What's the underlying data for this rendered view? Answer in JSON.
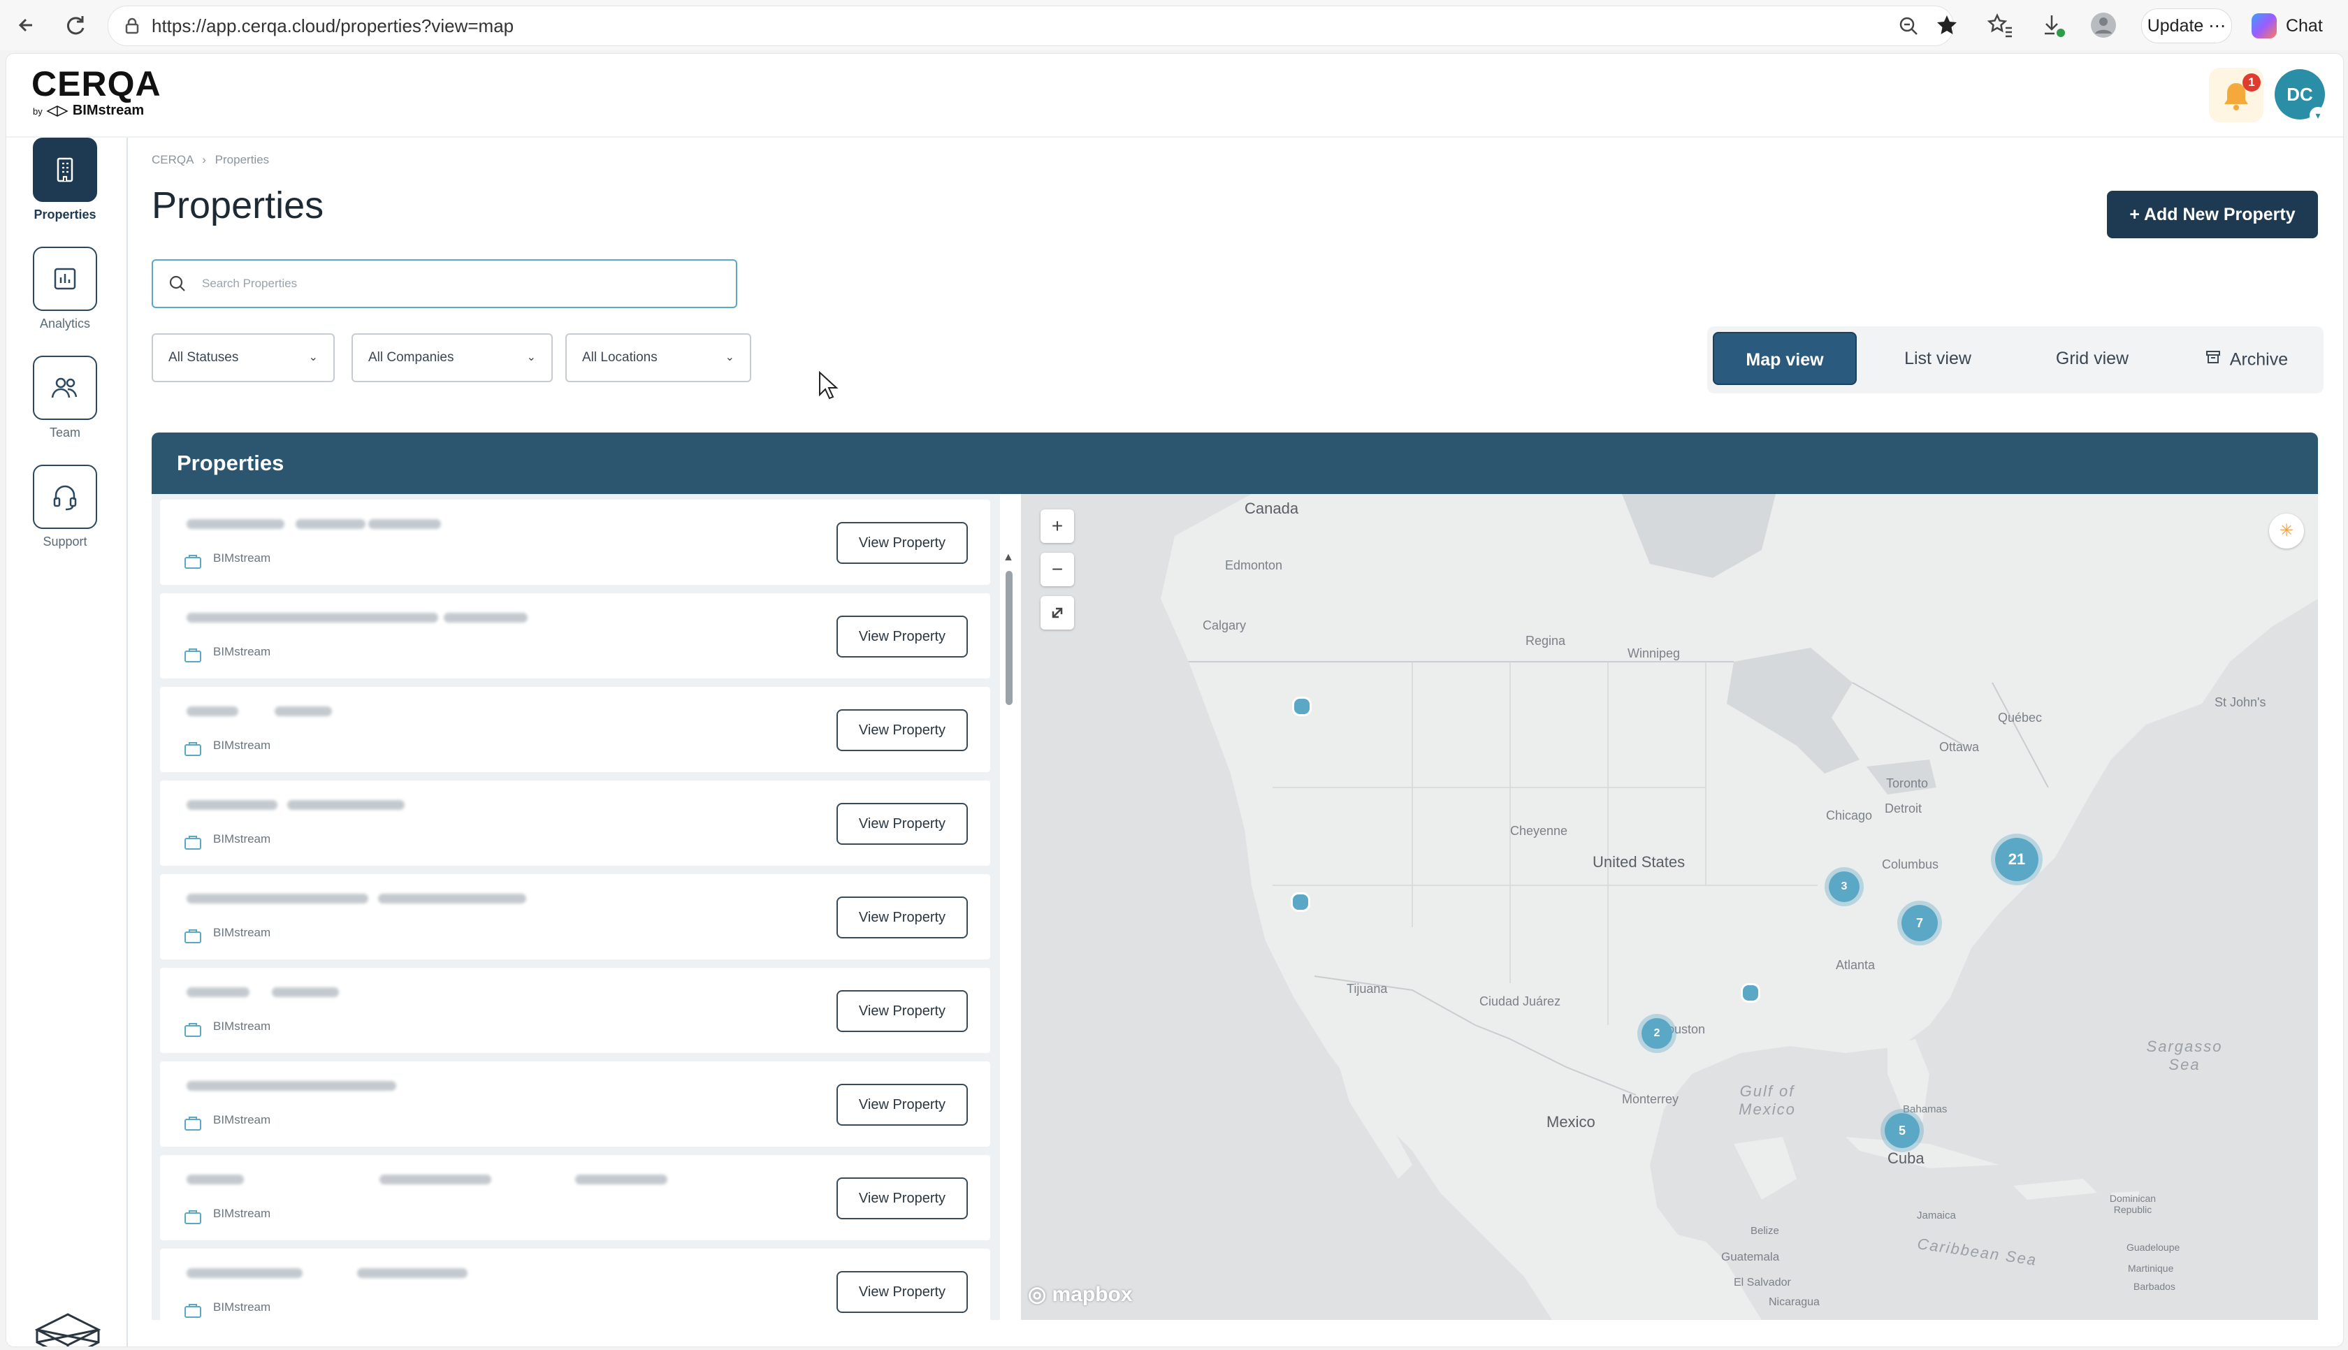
{
  "browser": {
    "url": "https://app.cerqa.cloud/properties?view=map",
    "update_label": "Update",
    "chat_label": "Chat"
  },
  "header": {
    "logo_main": "CERQA",
    "logo_by": "by",
    "logo_brand": "BIMstream",
    "notification_count": "1",
    "avatar_initials": "DC"
  },
  "sidebar": {
    "items": [
      {
        "label": "Properties",
        "icon": "building-icon",
        "active": true
      },
      {
        "label": "Analytics",
        "icon": "chart-icon",
        "active": false
      },
      {
        "label": "Team",
        "icon": "team-icon",
        "active": false
      },
      {
        "label": "Support",
        "icon": "headset-icon",
        "active": false
      }
    ]
  },
  "breadcrumb": {
    "root": "CERQA",
    "separator": "›",
    "current": "Properties"
  },
  "page": {
    "title": "Properties",
    "add_button": "+ Add New Property"
  },
  "search": {
    "placeholder": "Search Properties",
    "value": ""
  },
  "filters": {
    "status": "All Statuses",
    "company": "All Companies",
    "location": "All Locations"
  },
  "views": {
    "map": "Map view",
    "list": "List view",
    "grid": "Grid view",
    "archive": "Archive",
    "active": "map"
  },
  "panel": {
    "title": "Properties"
  },
  "properties": [
    {
      "company": "BIMstream",
      "action": "View Property"
    },
    {
      "company": "BIMstream",
      "action": "View Property"
    },
    {
      "company": "BIMstream",
      "action": "View Property"
    },
    {
      "company": "BIMstream",
      "action": "View Property"
    },
    {
      "company": "BIMstream",
      "action": "View Property"
    },
    {
      "company": "BIMstream",
      "action": "View Property"
    },
    {
      "company": "BIMstream",
      "action": "View Property"
    },
    {
      "company": "BIMstream",
      "action": "View Property"
    },
    {
      "company": "BIMstream",
      "action": "View Property"
    }
  ],
  "map": {
    "attribution": "mapbox",
    "zoom_in": "+",
    "zoom_out": "−",
    "labels": {
      "canada": "Canada",
      "united_states": "United States",
      "mexico": "Mexico",
      "cuba": "Cuba",
      "gulf": "Gulf of Mexico",
      "sargasso": "Sargasso Sea",
      "caribbean": "Caribbean Sea",
      "edmonton": "Edmonton",
      "calgary": "Calgary",
      "regina": "Regina",
      "winnipeg": "Winnipeg",
      "chicago": "Chicago",
      "toronto": "Toronto",
      "ottawa": "Ottawa",
      "quebec": "Québec",
      "detroit": "Detroit",
      "columbus": "Columbus",
      "cheyenne": "Cheyenne",
      "atlanta": "Atlanta",
      "houston": "Houston",
      "monterrey": "Monterrey",
      "tijuana": "Tijuana",
      "ciudad_juarez": "Ciudad Juárez",
      "guatemala": "Guatemala",
      "el_salvador": "El Salvador",
      "nicaragua": "Nicaragua",
      "belize": "Belize",
      "jamaica": "Jamaica",
      "bahamas": "Bahamas",
      "st_johns": "St John's",
      "dominican_republic": "Dominican Republic",
      "guadeloupe": "Guadeloupe",
      "martinique": "Martinique",
      "barbados": "Barbados"
    },
    "clusters": [
      {
        "count": "21"
      },
      {
        "count": "7"
      },
      {
        "count": "3"
      },
      {
        "count": "2"
      },
      {
        "count": "5"
      }
    ]
  },
  "colors": {
    "primary": "#1e3a52",
    "panel_header": "#2c5570",
    "cluster": "#5aa7c6",
    "notification": "#e03b2f"
  }
}
